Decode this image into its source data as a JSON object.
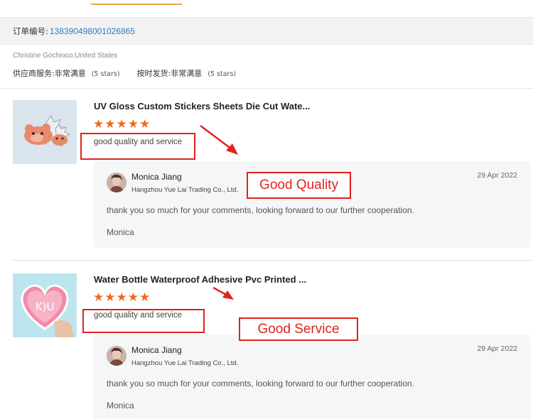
{
  "order": {
    "label": "订单编号:",
    "number": "138390498001026865"
  },
  "buyer": "Christine Gochioco,United States",
  "ratings": [
    {
      "label": "供应商服务:",
      "value": "非常满意",
      "stars": "(5 stars)"
    },
    {
      "label": "按时发货:",
      "value": "非常满意",
      "stars": "(5 stars)"
    }
  ],
  "reviews": [
    {
      "title": "UV Gloss Custom Stickers Sheets Die Cut Wate...",
      "stars": "★★★★★",
      "comment": "good quality and service",
      "reply": {
        "name": "Monica Jiang",
        "company": "Hangzhou Yue Lai Trading Co., Ltd.",
        "date": "29 Apr 2022",
        "text": "thank you so much for your comments, looking forward to our further cooperation.",
        "sign": "Monica"
      },
      "annotation": "Good Quality"
    },
    {
      "title": "Water Bottle Waterproof Adhesive Pvc Printed ...",
      "stars": "★★★★★",
      "comment": "good quality and service",
      "reply": {
        "name": "Monica Jiang",
        "company": "Hangzhou Yue Lai Trading Co., Ltd.",
        "date": "29 Apr 2022",
        "text": "thank you so much for your comments, looking forward to our further cooperation.",
        "sign": "Monica"
      },
      "annotation": "Good Service"
    }
  ],
  "colors": {
    "accent_tab": "#e8a33d",
    "link": "#2f7bbf",
    "star": "#f06a1b",
    "annotation_red": "#e0231b"
  }
}
